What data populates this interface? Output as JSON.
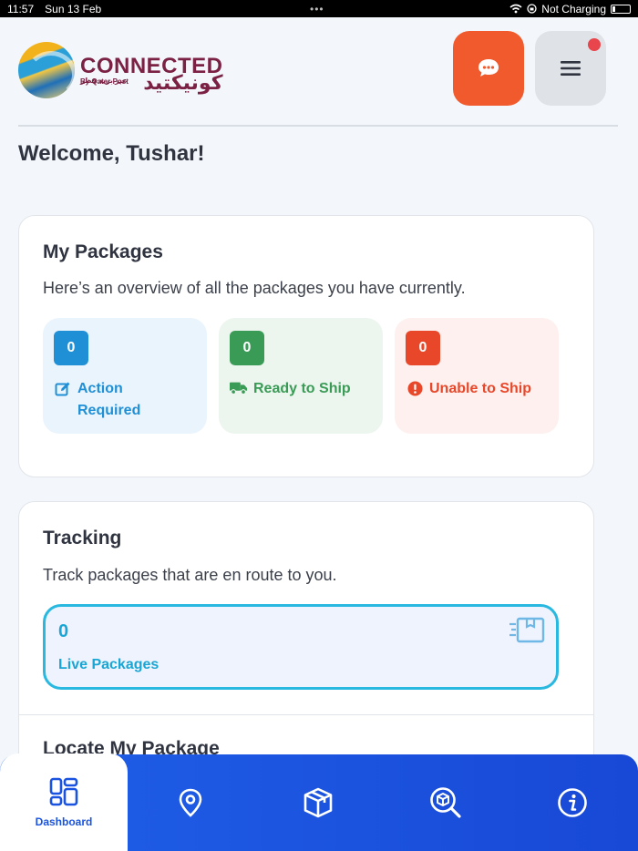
{
  "status_bar": {
    "time": "11:57",
    "date": "Sun 13 Feb",
    "battery_status": "Not Charging"
  },
  "header": {
    "logo_main": "CONNECTED",
    "logo_sub": "By Qatar Post",
    "logo_arabic": "كونيكتيد",
    "logo_arabic_sub": "عبر بريد قطر",
    "chat_icon": "chat-bubble-icon",
    "menu_icon": "hamburger-icon",
    "colors": {
      "chat": "#f05a2c",
      "menu": "#dfe2e6",
      "notif": "#e8464c",
      "brand": "#7b2144"
    }
  },
  "welcome": "Welcome, Tushar!",
  "my_packages": {
    "title": "My Packages",
    "description": "Here’s an overview of all the packages you have currently.",
    "tiles": [
      {
        "count": "0",
        "label_line1": "Action",
        "label_line2": "Required",
        "icon": "edit-icon",
        "color": "#1f8fd6",
        "bg": "#eaf4fd"
      },
      {
        "count": "0",
        "label_line1": "Ready to Ship",
        "icon": "truck-icon",
        "color": "#3a9b56",
        "bg": "#edf5ef"
      },
      {
        "count": "0",
        "label_line1": "Unable to Ship",
        "icon": "alert-icon",
        "color": "#e8472a",
        "bg": "#fdf0ee"
      }
    ]
  },
  "tracking": {
    "title": "Tracking",
    "description": "Track packages that are en route to you.",
    "live_count": "0",
    "live_label": "Live Packages",
    "icon": "shipping-box-icon",
    "color": "#28b8e0"
  },
  "locate": {
    "title": "Locate My Package"
  },
  "bottom_nav": {
    "items": [
      {
        "label": "Dashboard",
        "icon": "dashboard-icon"
      },
      {
        "icon": "location-pin-icon"
      },
      {
        "icon": "package-icon"
      },
      {
        "icon": "package-search-icon"
      },
      {
        "icon": "info-icon"
      }
    ],
    "colors": {
      "bar": "#1f60e8",
      "active_text": "#1a53e0"
    }
  }
}
